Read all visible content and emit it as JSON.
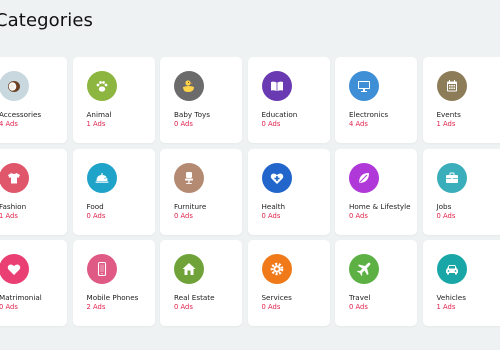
{
  "page": {
    "title": "Categories"
  },
  "categories": [
    {
      "label": "Accessories",
      "count": "4 Ads",
      "icon": "coconut-icon",
      "color": "#c8d8de"
    },
    {
      "label": "Animal",
      "count": "1 Ads",
      "icon": "paw-icon",
      "color": "#8cb640"
    },
    {
      "label": "Baby Toys",
      "count": "0 Ads",
      "icon": "duck-icon",
      "color": "#6b6b6b"
    },
    {
      "label": "Education",
      "count": "0 Ads",
      "icon": "book-icon",
      "color": "#6a3ab2"
    },
    {
      "label": "Electronics",
      "count": "4 Ads",
      "icon": "monitor-icon",
      "color": "#3f8fd6"
    },
    {
      "label": "Events",
      "count": "1 Ads",
      "icon": "calendar-icon",
      "color": "#8c7d58"
    },
    {
      "label": "Fashion",
      "count": "1 Ads",
      "icon": "tshirt-icon",
      "color": "#e0566a"
    },
    {
      "label": "Food",
      "count": "0 Ads",
      "icon": "food-cloche-icon",
      "color": "#1fa3c9"
    },
    {
      "label": "Furniture",
      "count": "0 Ads",
      "icon": "chair-icon",
      "color": "#b48b72"
    },
    {
      "label": "Health",
      "count": "0 Ads",
      "icon": "heart-plus-icon",
      "color": "#2266cc"
    },
    {
      "label": "Home & Lifestyle",
      "count": "0 Ads",
      "icon": "leaf-icon",
      "color": "#b038d8"
    },
    {
      "label": "Jobs",
      "count": "0 Ads",
      "icon": "briefcase-icon",
      "color": "#3aaebb"
    },
    {
      "label": "Matrimonial",
      "count": "0 Ads",
      "icon": "heart-icon",
      "color": "#ea3f72"
    },
    {
      "label": "Mobile Phones",
      "count": "2 Ads",
      "icon": "mobile-phone-icon",
      "color": "#e05a86"
    },
    {
      "label": "Real Estate",
      "count": "0 Ads",
      "icon": "house-icon",
      "color": "#6fa33a"
    },
    {
      "label": "Services",
      "count": "0 Ads",
      "icon": "gear-icon",
      "color": "#f07a1a"
    },
    {
      "label": "Travel",
      "count": "0 Ads",
      "icon": "airplane-icon",
      "color": "#5db044"
    },
    {
      "label": "Vehicles",
      "count": "1 Ads",
      "icon": "car-icon",
      "color": "#18a6a6"
    }
  ]
}
